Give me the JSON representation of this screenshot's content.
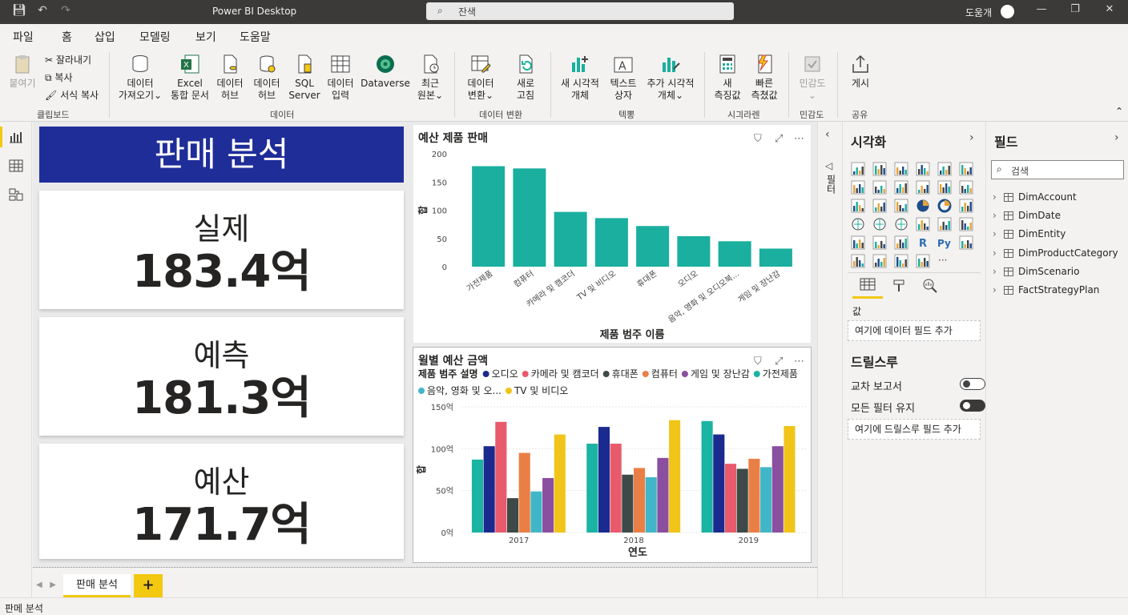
{
  "titlebar": {
    "title": "Power BI Desktop",
    "search": "잔색",
    "user": "도움개"
  },
  "menu": [
    "파일",
    "홈",
    "삽입",
    "모델링",
    "보기",
    "도움말"
  ],
  "ribbon": {
    "clipboard": {
      "paste": "붙여기",
      "cut": "잘라내기",
      "copy": "복사",
      "format_copy": "서식 복사",
      "group": "클립보드"
    },
    "data": {
      "get_data": [
        "데이터",
        "가져오기"
      ],
      "excel": [
        "Excel",
        "통합 문서"
      ],
      "hub1": [
        "데이터",
        "허브"
      ],
      "hub2": [
        "데이터",
        "허브"
      ],
      "sql": [
        "SQL",
        "Server"
      ],
      "enter": [
        "데이터",
        "입력"
      ],
      "dataverse": "Dataverse",
      "recent": [
        "최근",
        "원본"
      ],
      "group": "데이터"
    },
    "transform": {
      "transform": [
        "데이터",
        "변환"
      ],
      "refresh": [
        "새로",
        "고침"
      ],
      "group": "데이터 변환"
    },
    "insert": {
      "new_visual": [
        "새 시각적",
        "개체"
      ],
      "textbox": [
        "텍스트",
        "상자"
      ],
      "more_visuals": [
        "추가 시각적",
        "개체"
      ],
      "group": "텍뽕"
    },
    "calc": {
      "new_measure": [
        "새",
        "측징값"
      ],
      "quick_measure": [
        "빠른",
        "측쳤값"
      ],
      "group": "시긔라렌"
    },
    "sensitivity": {
      "label": "민감도",
      "group": "민감도"
    },
    "share": {
      "publish": "게시",
      "group": "공유"
    }
  },
  "report": {
    "title": "판매 분석",
    "kpis": [
      {
        "label": "실제",
        "value": "183.4억"
      },
      {
        "label": "예측",
        "value": "181.3억"
      },
      {
        "label": "예산",
        "value": "171.7억"
      }
    ]
  },
  "chart_data": [
    {
      "type": "bar",
      "title": "예산 제품 판매",
      "xlabel": "제품 범주 이름",
      "ylabel": "합",
      "categories": [
        "가전제품",
        "컴퓨터",
        "카메라 및 캠코더",
        "TV 및 비디오",
        "휴대폰",
        "오디오",
        "음악, 영화 및 오디오북...",
        "게임 및 장난감"
      ],
      "values": [
        178,
        174,
        97,
        86,
        72,
        54,
        45,
        32
      ],
      "ylim": [
        0,
        200
      ],
      "yticks": [
        "0",
        "50",
        "100",
        "150",
        "200"
      ],
      "color": "#1aaf9e"
    },
    {
      "type": "bar",
      "title": "윌별 예산 금액",
      "xlabel": "연도",
      "ylabel": "합",
      "legend_title": "제품 범주 설명",
      "categories": [
        "2017",
        "2018",
        "2019"
      ],
      "yticks": [
        "0억",
        "50억",
        "100억",
        "150억"
      ],
      "ylim": [
        0,
        150
      ],
      "series": [
        {
          "name": "가전제품",
          "color": "#1ab4a3",
          "values": [
            87,
            106,
            133
          ]
        },
        {
          "name": "오디오",
          "color": "#1b2a8f",
          "values": [
            103,
            126,
            117
          ]
        },
        {
          "name": "카메라 및 캠코더",
          "color": "#e85a6c",
          "values": [
            132,
            106,
            82
          ]
        },
        {
          "name": "휴대폰",
          "color": "#3d4a48",
          "values": [
            41,
            69,
            76
          ]
        },
        {
          "name": "컴퓨터",
          "color": "#ea7f45",
          "values": [
            95,
            77,
            88
          ]
        },
        {
          "name": "음악, 영화 및 오...",
          "color": "#42b6c9",
          "values": [
            49,
            66,
            78
          ]
        },
        {
          "name": "게임 및 장난감",
          "color": "#8a4f9e",
          "values": [
            65,
            89,
            103
          ]
        },
        {
          "name": "TV 및 비디오",
          "color": "#f0c419",
          "values": [
            117,
            134,
            127
          ]
        }
      ],
      "legend_order": [
        "오디오",
        "카메라 및 캠코더",
        "휴대폰",
        "컴퓨터",
        "게임 및 장난감",
        "가전제품",
        "음악, 영화 및 오...",
        "TV 및 비디오"
      ]
    }
  ],
  "filters_label": "필터",
  "viz_pane": {
    "title": "시각화",
    "values_label": "값",
    "add_data_field": "여기에 데이터 필드 추가",
    "drillthrough_title": "드릴스루",
    "cross_report": "교차 보고서",
    "keep_filters": "모든 필터 유지",
    "add_drill_field": "여기에 드릴스루 필드 추가",
    "cross_report_on": false,
    "keep_filters_on": true
  },
  "fields_pane": {
    "title": "필드",
    "search_placeholder": "검색",
    "tables": [
      "DimAccount",
      "DimDate",
      "DimEntity",
      "DimProductCategory",
      "DimScenario",
      "FactStrategyPlan"
    ]
  },
  "page_tab": "판매 분석",
  "status": "판메 분석"
}
